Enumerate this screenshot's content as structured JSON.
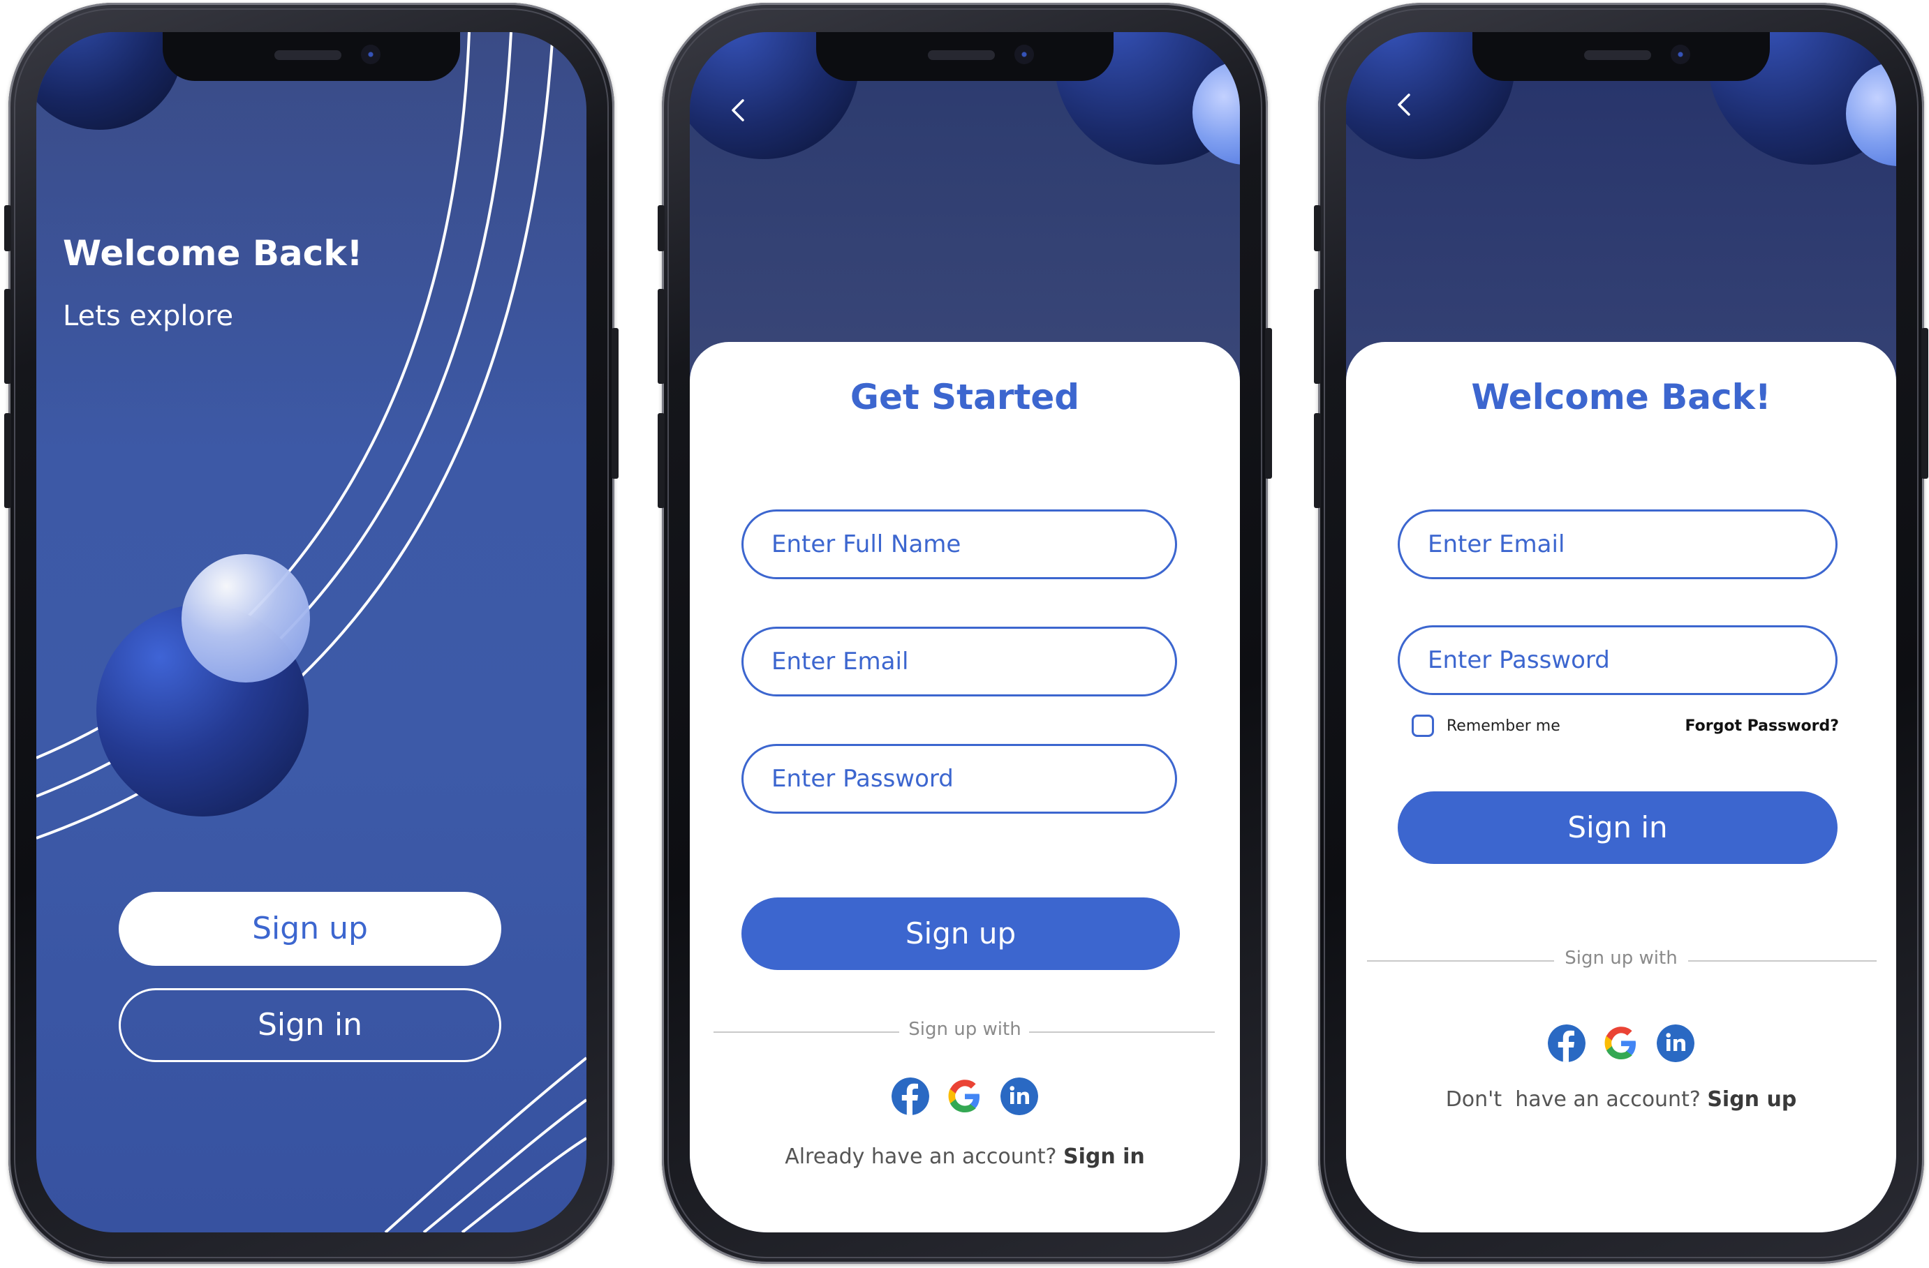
{
  "colors": {
    "accent": "#3c66cf",
    "hero_blue": "#3b5aa8",
    "header_navy": "#3a4775",
    "white": "#ffffff"
  },
  "screen1": {
    "title": "Welcome Back!",
    "subtitle": "Lets explore",
    "signup_label": "Sign up",
    "signin_label": "Sign in"
  },
  "screen2": {
    "back_icon": "chevron-left-icon",
    "title": "Get Started",
    "fields": {
      "fullname_placeholder": "Enter Full Name",
      "email_placeholder": "Enter Email",
      "password_placeholder": "Enter Password"
    },
    "signup_label": "Sign up",
    "divider_text": "Sign up with",
    "social_icons": [
      "facebook-icon",
      "google-icon",
      "linkedin-icon"
    ],
    "footer_prompt": "Already have an account?",
    "footer_link": "Sign in"
  },
  "screen3": {
    "back_icon": "chevron-left-icon",
    "title": "Welcome Back!",
    "fields": {
      "email_placeholder": "Enter Email",
      "password_placeholder": "Enter Password"
    },
    "remember_label": "Remember me",
    "forgot_label": "Forgot Password?",
    "signin_label": "Sign in",
    "divider_text": "Sign up with",
    "social_icons": [
      "facebook-icon",
      "google-icon",
      "linkedin-icon"
    ],
    "footer_prompt": "Don't  have an account?",
    "footer_link": "Sign up"
  }
}
